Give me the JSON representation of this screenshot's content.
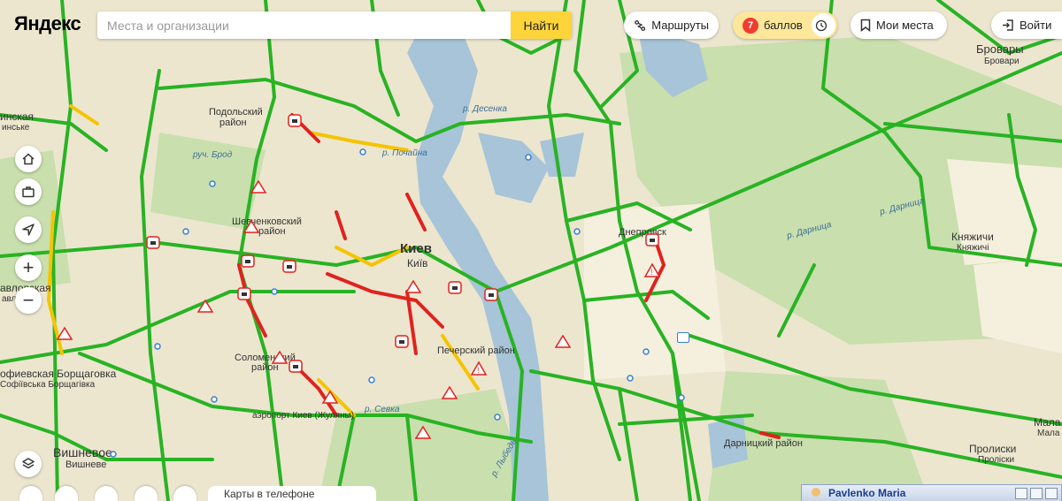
{
  "header": {
    "logo_text": "Яндекс",
    "search_placeholder": "Места и организации",
    "search_button": "Найти",
    "routes_label": "Маршруты",
    "score_value": "7",
    "score_label": "баллов",
    "my_places_label": "Мои места",
    "login_label": "Войти"
  },
  "controls": {
    "home": "home-icon",
    "work": "briefcase-icon",
    "locate": "location-arrow-icon",
    "zoom_in": "+",
    "zoom_out": "−",
    "layers": "layers-icon"
  },
  "bottom": {
    "phone_promo": "Карты в телефоне"
  },
  "chat_window": {
    "contact_name": "Pavlenko Maria"
  },
  "map_labels": {
    "kiev": "Киев",
    "kiev_sub": "Київ",
    "podolsky": "Подольский",
    "podolsky_sub": "район",
    "shevchenko": "Шевченковский",
    "shevchenko_sub": "район",
    "solomensky": "Соломенский",
    "solomensky_sub": "район",
    "pechersky": "Печерский район",
    "dnepr": "Днепровск",
    "darnitsky": "Дарницкий район",
    "brovary": "Бровары",
    "brovary_sub": "Бровари",
    "knyazhichi": "Княжичи",
    "knyazhichi_sub": "Княжичі",
    "vishnevoe": "Вишневое",
    "vishnevoe_sub": "Вишневе",
    "sofievskaya": "офиевская Борщаговка",
    "sofievskaya_sub": "Софіївська Борщагівка",
    "pirogov": "Пролиски",
    "pirogov_sub": "Пролiски",
    "mala": "Мала",
    "mala_sub": "Мала",
    "pavlovskaya": "авловская",
    "pavlovskaya_sub": "авлів",
    "belichi": "инская",
    "belichi_sub": "инське",
    "r_desenka": "р. Десенка",
    "r_pochayna": "р. Почайна",
    "r_brod": "руч. Брод",
    "r_lybed": "р. Лыбедь",
    "r_darnitsa": "р. Дарница",
    "r_darnitsa2": "р. Дарница",
    "r_sevka": "р. Севка",
    "airport": "аэропорт Киев (Жуляны)"
  },
  "colors": {
    "map_bg": "#ece6cf",
    "water": "#a7c4d8",
    "green_area": "#c9dfad",
    "traffic_free": "#28b323",
    "traffic_slow": "#f5c400",
    "traffic_jam": "#e0221f",
    "accent": "#fdd43a"
  }
}
